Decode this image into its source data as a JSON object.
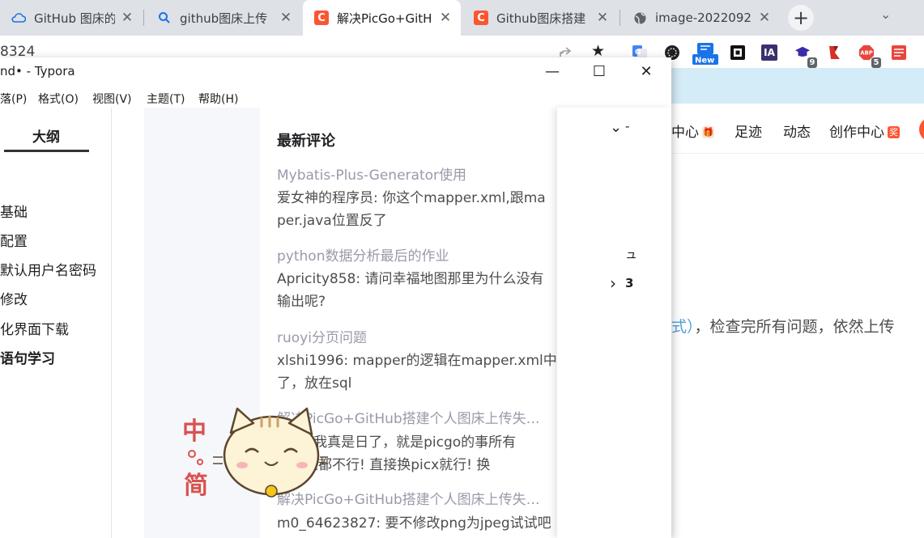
{
  "browser": {
    "tabs": [
      {
        "title": "GitHub 图床的正",
        "icon": "cloud-icon",
        "active": false
      },
      {
        "title": "github图床上传",
        "icon": "search-icon",
        "active": false
      },
      {
        "title": "解决PicGo+GitH",
        "icon": "csdn-icon",
        "active": true
      },
      {
        "title": "Github图床搭建",
        "icon": "csdn-icon",
        "active": false
      },
      {
        "title": "image-2022092",
        "icon": "globe-icon",
        "active": false
      }
    ],
    "close_glyph": "✕",
    "new_tab_glyph": "+",
    "tab_menu_glyph": "⌄",
    "url_fragment": "8324",
    "extensions": [
      {
        "name": "google-translate-icon",
        "label": "G"
      },
      {
        "name": "dark-mode-icon",
        "label": "◐"
      },
      {
        "name": "new-extension-icon",
        "label": "New"
      },
      {
        "name": "square-extension-icon",
        "label": "▣"
      },
      {
        "name": "ia-extension-icon",
        "label": "IA"
      },
      {
        "name": "graduation-extension-icon",
        "label": "◆",
        "badge": "9"
      },
      {
        "name": "bookmark-extension-icon",
        "label": "▲"
      },
      {
        "name": "adblock-extension-icon",
        "label": "ABP",
        "badge": "5"
      },
      {
        "name": "notes-extension-icon",
        "label": "≡"
      }
    ],
    "colors": {
      "tabbar": "#dee1e6",
      "bookmarks_bar": "#d4ecf7",
      "csdn_red": "#fc5531"
    }
  },
  "csdn": {
    "nav": [
      {
        "label": "中心",
        "badge": "🎁"
      },
      {
        "label": "足迹"
      },
      {
        "label": "动态"
      },
      {
        "label": "创作中心",
        "badge": "奖"
      }
    ],
    "article_link": "式）",
    "article_rest": "，检查完所有问题，依然上传"
  },
  "typora": {
    "title": "nd• - Typora",
    "window_buttons": {
      "minimize": "—",
      "maximize": "☐",
      "close": "✕"
    },
    "menu": [
      "落(P)",
      "格式(O)",
      "视图(V)",
      "主题(T)",
      "帮助(H)"
    ],
    "outline_tab": "大纲",
    "outline": [
      {
        "label": "基础",
        "bold": false
      },
      {
        "label": "配置",
        "bold": false
      },
      {
        "label": "默认用户名密码",
        "bold": false
      },
      {
        "label": "修改",
        "bold": false
      },
      {
        "label": "化界面下载",
        "bold": false
      },
      {
        "label": "语句学习",
        "bold": true
      }
    ]
  },
  "comments": {
    "heading": "最新评论",
    "items": [
      {
        "title": "Mybatis-Plus-Generator使用",
        "lines": [
          "爱女神的程序员: 你这个mapper.xml,跟ma",
          "per.java位置反了"
        ]
      },
      {
        "title": "python数据分析最后的作业",
        "lines": [
          "Apricity858: 请问幸福地图那里为什么没有",
          "输出呢?"
        ]
      },
      {
        "title": "ruoyi分页问题",
        "lines": [
          "xlshi1996: mapper的逻辑在mapper.xml中",
          "了，放在sql"
        ]
      },
      {
        "title": "解决PicGo+GitHub搭建个人图床上传失…",
        "lines": [
          "丶丶: 我真是日了，就是picgo的事所有",
          "都试过都不行! 直接换picx就行! 换"
        ]
      },
      {
        "title": "解决PicGo+GitHub搭建个人图床上传失…",
        "lines": [
          "m0_64623827: 要不修改png为jpeg试试吧"
        ]
      }
    ]
  },
  "right_panel": {
    "chevron_down": "⌄",
    "chevron_right": "›",
    "fragment_1": "-",
    "fragment_2": "ュ",
    "fragment_3": "3"
  },
  "sticker": {
    "chars": [
      "中",
      "简"
    ]
  }
}
